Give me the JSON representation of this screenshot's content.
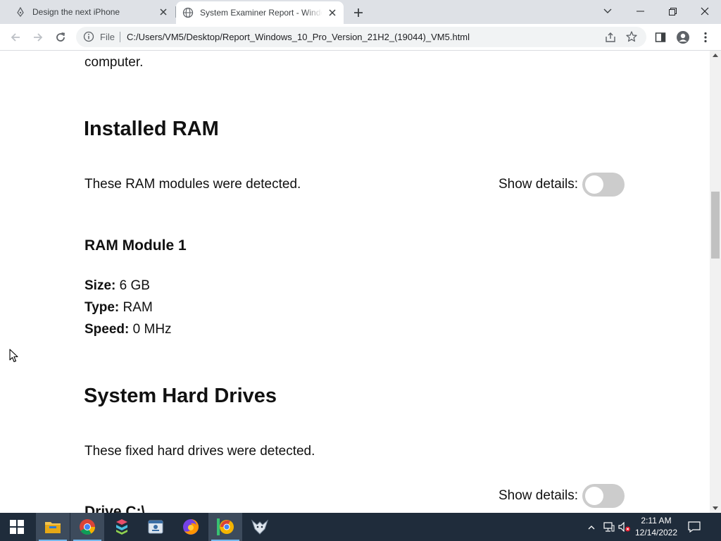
{
  "browser": {
    "tabs": [
      {
        "title": "Design the next iPhone",
        "icon": "pen-nib-icon",
        "active": false
      },
      {
        "title": "System Examiner Report - Windo",
        "icon": "globe-icon",
        "active": true
      }
    ],
    "address": {
      "scheme_label": "File",
      "url": "C:/Users/VM5/Desktop/Report_Windows_10_Pro_Version_21H2_(19044)_VM5.html"
    },
    "colors": {
      "tabstrip": "#dee1e6",
      "omnibox": "#f1f3f4"
    }
  },
  "page": {
    "intro_tail": "computer.",
    "installed_ram": {
      "heading": "Installed RAM",
      "description": "These RAM modules were detected.",
      "show_details_label": "Show details:",
      "show_details_on": false,
      "module": {
        "title": "RAM Module 1",
        "size_label": "Size:",
        "size_value": "6 GB",
        "type_label": "Type:",
        "type_value": "RAM",
        "speed_label": "Speed:",
        "speed_value": "0 MHz"
      }
    },
    "hard_drives": {
      "heading": "System Hard Drives",
      "description": "These fixed hard drives were detected.",
      "show_details_label": "Show details:",
      "show_details_on": false,
      "drive_title": "Drive C:\\"
    },
    "colors": {
      "toggle_off": "#cccccc",
      "text": "#111111"
    }
  },
  "taskbar": {
    "apps": [
      "start-icon",
      "file-explorer-icon",
      "chrome-icon",
      "stacked-app-icon",
      "id-card-app-icon",
      "firefox-icon",
      "chrome-green-icon",
      "wolf-app-icon"
    ],
    "clock": {
      "time": "2:11 AM",
      "date": "12/14/2022"
    },
    "colors": {
      "background": "#1f2c3b",
      "active": "#3d4b5c"
    }
  }
}
